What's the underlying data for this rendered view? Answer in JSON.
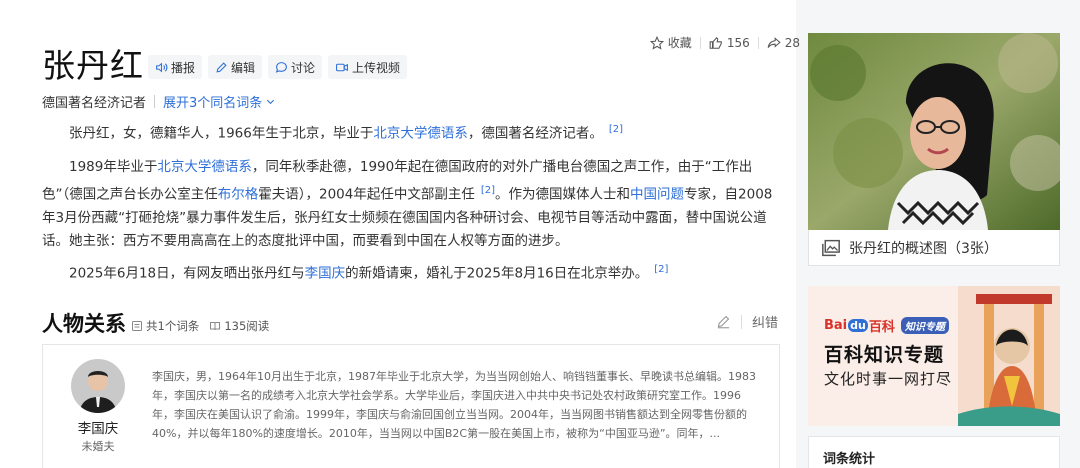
{
  "entry": {
    "title": "张丹红",
    "subtitle": "德国著名经济记者",
    "expand_label": "展开3个同名词条",
    "actions": [
      {
        "label": "播报",
        "icon": "speaker-icon"
      },
      {
        "label": "编辑",
        "icon": "pencil-icon"
      },
      {
        "label": "讨论",
        "icon": "chat-icon"
      },
      {
        "label": "上传视频",
        "icon": "video-icon"
      }
    ],
    "stats": {
      "favorite_label": "收藏",
      "likes": "156",
      "shares": "28"
    }
  },
  "summary": {
    "p1": {
      "t1": "张丹红，女，德籍华人，1966年生于北京，毕业于",
      "l1": "北京大学德语系",
      "t2": "，德国著名经济记者。",
      "ref": "[2]"
    },
    "p2": {
      "t1": "1989年毕业于",
      "l1": "北京大学德语系",
      "t2": "，同年秋季赴德，1990年起在德国政府的对外广播电台德国之声工作，由于“工作出色”（德国之声台长办公室主任",
      "l2": "布尔格",
      "t3": "霍夫语），2004年起任中文部副主任",
      "ref1": "[2]",
      "t4": "。作为德国媒体人士和",
      "l3": "中国问题",
      "t5": "专家，自2008年3月份西藏“打砸抢烧”暴力事件发生后，张丹红女士频频在德国国内各种研讨会、电视节目等活动中露面，替中国说公道话。她主张：西方不要用高高在上的态度批评中国，而要看到中国在人权等方面的进步。"
    },
    "p3": {
      "t1": "2025年6月18日，有网友晒出张丹红与",
      "l1": "李国庆",
      "t2": "的新婚请柬，婚礼于2025年8月16日在北京举办。",
      "ref": "[2]"
    }
  },
  "relations": {
    "title": "人物关系",
    "entries_count": "共1个词条",
    "reads": "135阅读",
    "correct_label": "纠错",
    "person": {
      "name": "李国庆",
      "relation": "未婚夫",
      "desc": "李国庆，男，1964年10月出生于北京，1987年毕业于北京大学，为当当网创始人、响铛铛董事长、早晚读书总编辑。1983年，李国庆以第一名的成绩考入北京大学社会学系。大学毕业后，李国庆进入中共中央书记处农村政策研究室工作。1996年，李国庆在美国认识了俞渝。1999年，李国庆与俞渝回国创立当当网。2004年，当当网图书销售额达到全网零售份额的40%，并以每年180%的速度增长。2010年，当当网以中国B2C第一股在美国上市，被称为“中国亚马逊”。同年，..."
    }
  },
  "sidebar": {
    "photo_caption": "张丹红的概述图（3张）",
    "banner": {
      "brand_logo": "Bai",
      "brand_logo2": "du",
      "brand_text": "百科",
      "brand_badge": "知识专题",
      "title": "百科知识专题",
      "subtitle": "文化时事一网打尽"
    },
    "stats_title": "词条统计"
  }
}
